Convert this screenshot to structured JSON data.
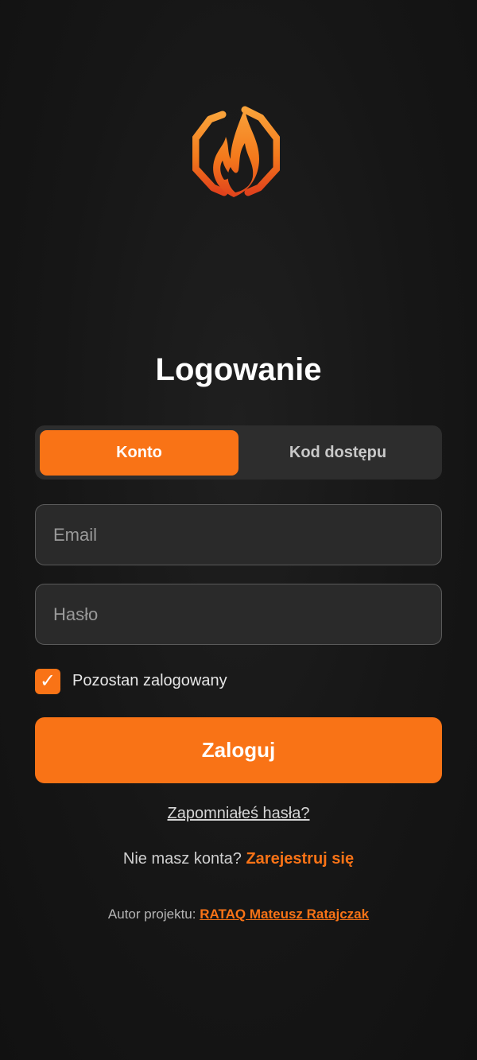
{
  "login": {
    "title": "Logowanie",
    "tabs": [
      {
        "label": "Konto",
        "active": true
      },
      {
        "label": "Kod dostępu",
        "active": false
      }
    ],
    "email_placeholder": "Email",
    "password_placeholder": "Hasło",
    "remember_label": "Pozostan zalogowany",
    "remember_checked": true,
    "checkmark": "✓",
    "submit_label": "Zaloguj",
    "forgot_link": "Zapomniałeś hasła?",
    "register_prompt": "Nie masz konta?",
    "register_link": "Zarejestruj się",
    "author_prefix": "Autor projektu:",
    "author_link": "RATAQ Mateusz Ratajczak"
  },
  "icons": {
    "logo": "flame-hexagon-logo-icon"
  },
  "colors": {
    "accent": "#f97316",
    "background": "#161616",
    "field_bg": "#2a2a2a",
    "field_border": "#5a5a5a"
  }
}
